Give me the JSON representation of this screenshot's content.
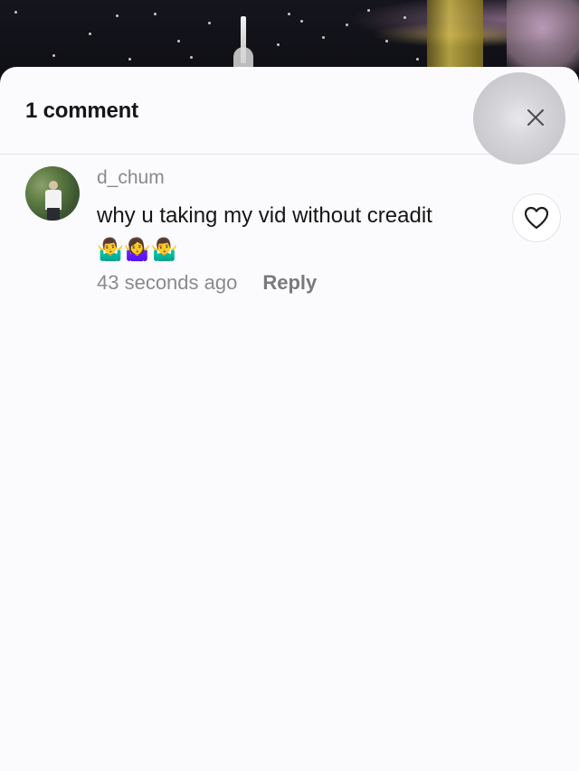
{
  "sheet": {
    "title": "1 comment"
  },
  "comment": {
    "username": "d_chum",
    "text": "why u taking my vid without creadit",
    "emojis": "🤷‍♂️🤷‍♀️🤷‍♂️",
    "timestamp": "43 seconds ago",
    "reply_label": "Reply"
  },
  "icons": {
    "close": "close-icon",
    "like": "heart-icon"
  },
  "colors": {
    "sheet_background": "#fbfbfd",
    "primary_text": "#161616",
    "secondary_text": "#8a8a8e"
  }
}
